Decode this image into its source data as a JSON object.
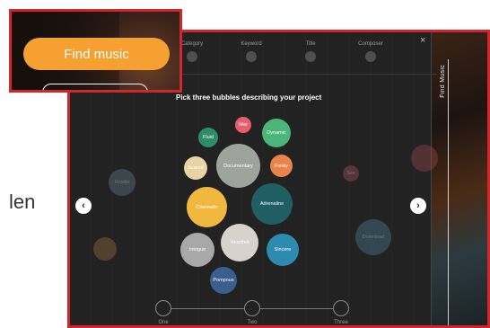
{
  "background": {
    "fragment_text": "len"
  },
  "modal": {
    "close_label": "×",
    "tabs": [
      {
        "label": "Category"
      },
      {
        "label": "Keyword"
      },
      {
        "label": "Title"
      },
      {
        "label": "Composer"
      }
    ],
    "prompt": "Pick three bubbles describing your project",
    "side_label": "Find Music",
    "bubbles": [
      {
        "label": "War"
      },
      {
        "label": "Fluid"
      },
      {
        "label": "Dynamic"
      },
      {
        "label": "Scared"
      },
      {
        "label": "Documentary"
      },
      {
        "label": "Funky"
      },
      {
        "label": "Cinematic"
      },
      {
        "label": "Adrenaline"
      },
      {
        "label": "Intrigue"
      },
      {
        "label": "Heartfelt"
      },
      {
        "label": "Sincere"
      },
      {
        "label": "Pompous"
      },
      {
        "label": "Hostile"
      },
      {
        "label": "Sex"
      },
      {
        "label": "Download"
      }
    ],
    "steps": [
      {
        "label": "One"
      },
      {
        "label": "Two"
      },
      {
        "label": "Three"
      }
    ],
    "left_arrow": "‹",
    "right_arrow": "›"
  },
  "overlay": {
    "find_button": "Find music"
  },
  "colors": {
    "accent_orange": "#f5a030",
    "highlight_red": "#d0262c"
  }
}
